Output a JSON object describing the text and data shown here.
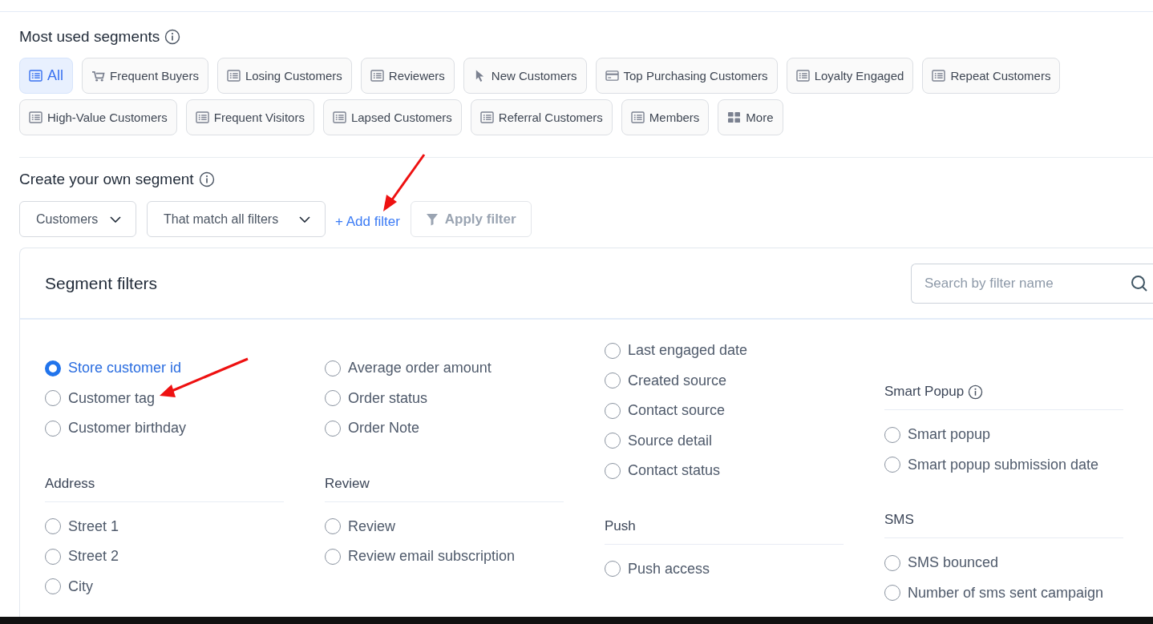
{
  "most_used": {
    "title": "Most used segments",
    "chips": [
      {
        "label": "All",
        "kind": "list",
        "selected": true
      },
      {
        "label": "Frequent Buyers",
        "kind": "cart",
        "selected": false
      },
      {
        "label": "Losing Customers",
        "kind": "list",
        "selected": false
      },
      {
        "label": "Reviewers",
        "kind": "list",
        "selected": false
      },
      {
        "label": "New Customers",
        "kind": "pointer",
        "selected": false
      },
      {
        "label": "Top Purchasing Customers",
        "kind": "card",
        "selected": false
      },
      {
        "label": "Loyalty Engaged",
        "kind": "list",
        "selected": false
      },
      {
        "label": "Repeat Customers",
        "kind": "list",
        "selected": false
      },
      {
        "label": "High-Value Customers",
        "kind": "list",
        "selected": false
      },
      {
        "label": "Frequent Visitors",
        "kind": "list",
        "selected": false
      },
      {
        "label": "Lapsed Customers",
        "kind": "list",
        "selected": false
      },
      {
        "label": "Referral Customers",
        "kind": "list",
        "selected": false
      },
      {
        "label": "Members",
        "kind": "list",
        "selected": false
      },
      {
        "label": "More",
        "kind": "grid",
        "selected": false
      }
    ]
  },
  "create": {
    "title": "Create your own segment",
    "entity_select": "Customers",
    "match_select": "That match all filters",
    "add_filter": "+ Add filter",
    "apply_filter": {
      "label": "Apply filter",
      "disabled": true
    }
  },
  "filters_panel": {
    "title": "Segment filters",
    "search": {
      "placeholder": "Search by filter name"
    },
    "columns": [
      [
        {
          "options": [
            {
              "label": "Store customer id",
              "selected": true
            },
            {
              "label": "Customer tag",
              "selected": false
            },
            {
              "label": "Customer birthday",
              "selected": false
            }
          ]
        },
        {
          "title": "Address",
          "options": [
            {
              "label": "Street 1",
              "selected": false
            },
            {
              "label": "Street 2",
              "selected": false
            },
            {
              "label": "City",
              "selected": false
            }
          ]
        }
      ],
      [
        {
          "options": [
            {
              "label": "Average order amount",
              "selected": false
            },
            {
              "label": "Order status",
              "selected": false
            },
            {
              "label": "Order Note",
              "selected": false
            }
          ]
        },
        {
          "title": "Review",
          "options": [
            {
              "label": "Review",
              "selected": false
            },
            {
              "label": "Review email subscription",
              "selected": false
            }
          ]
        }
      ],
      [
        {
          "options": [
            {
              "label": "Last engaged date",
              "selected": false
            },
            {
              "label": "Created source",
              "selected": false
            },
            {
              "label": "Contact source",
              "selected": false
            },
            {
              "label": "Source detail",
              "selected": false
            },
            {
              "label": "Contact status",
              "selected": false
            }
          ]
        },
        {
          "title": "Push",
          "options": [
            {
              "label": "Push access",
              "selected": false
            }
          ]
        }
      ],
      [
        {
          "title": "Smart Popup",
          "info": true,
          "options": [
            {
              "label": "Smart popup",
              "selected": false
            },
            {
              "label": "Smart popup submission date",
              "selected": false
            }
          ]
        },
        {
          "title": "SMS",
          "options": [
            {
              "label": "SMS bounced",
              "selected": false
            },
            {
              "label": "Number of sms sent campaign",
              "selected": false
            }
          ]
        }
      ]
    ]
  }
}
